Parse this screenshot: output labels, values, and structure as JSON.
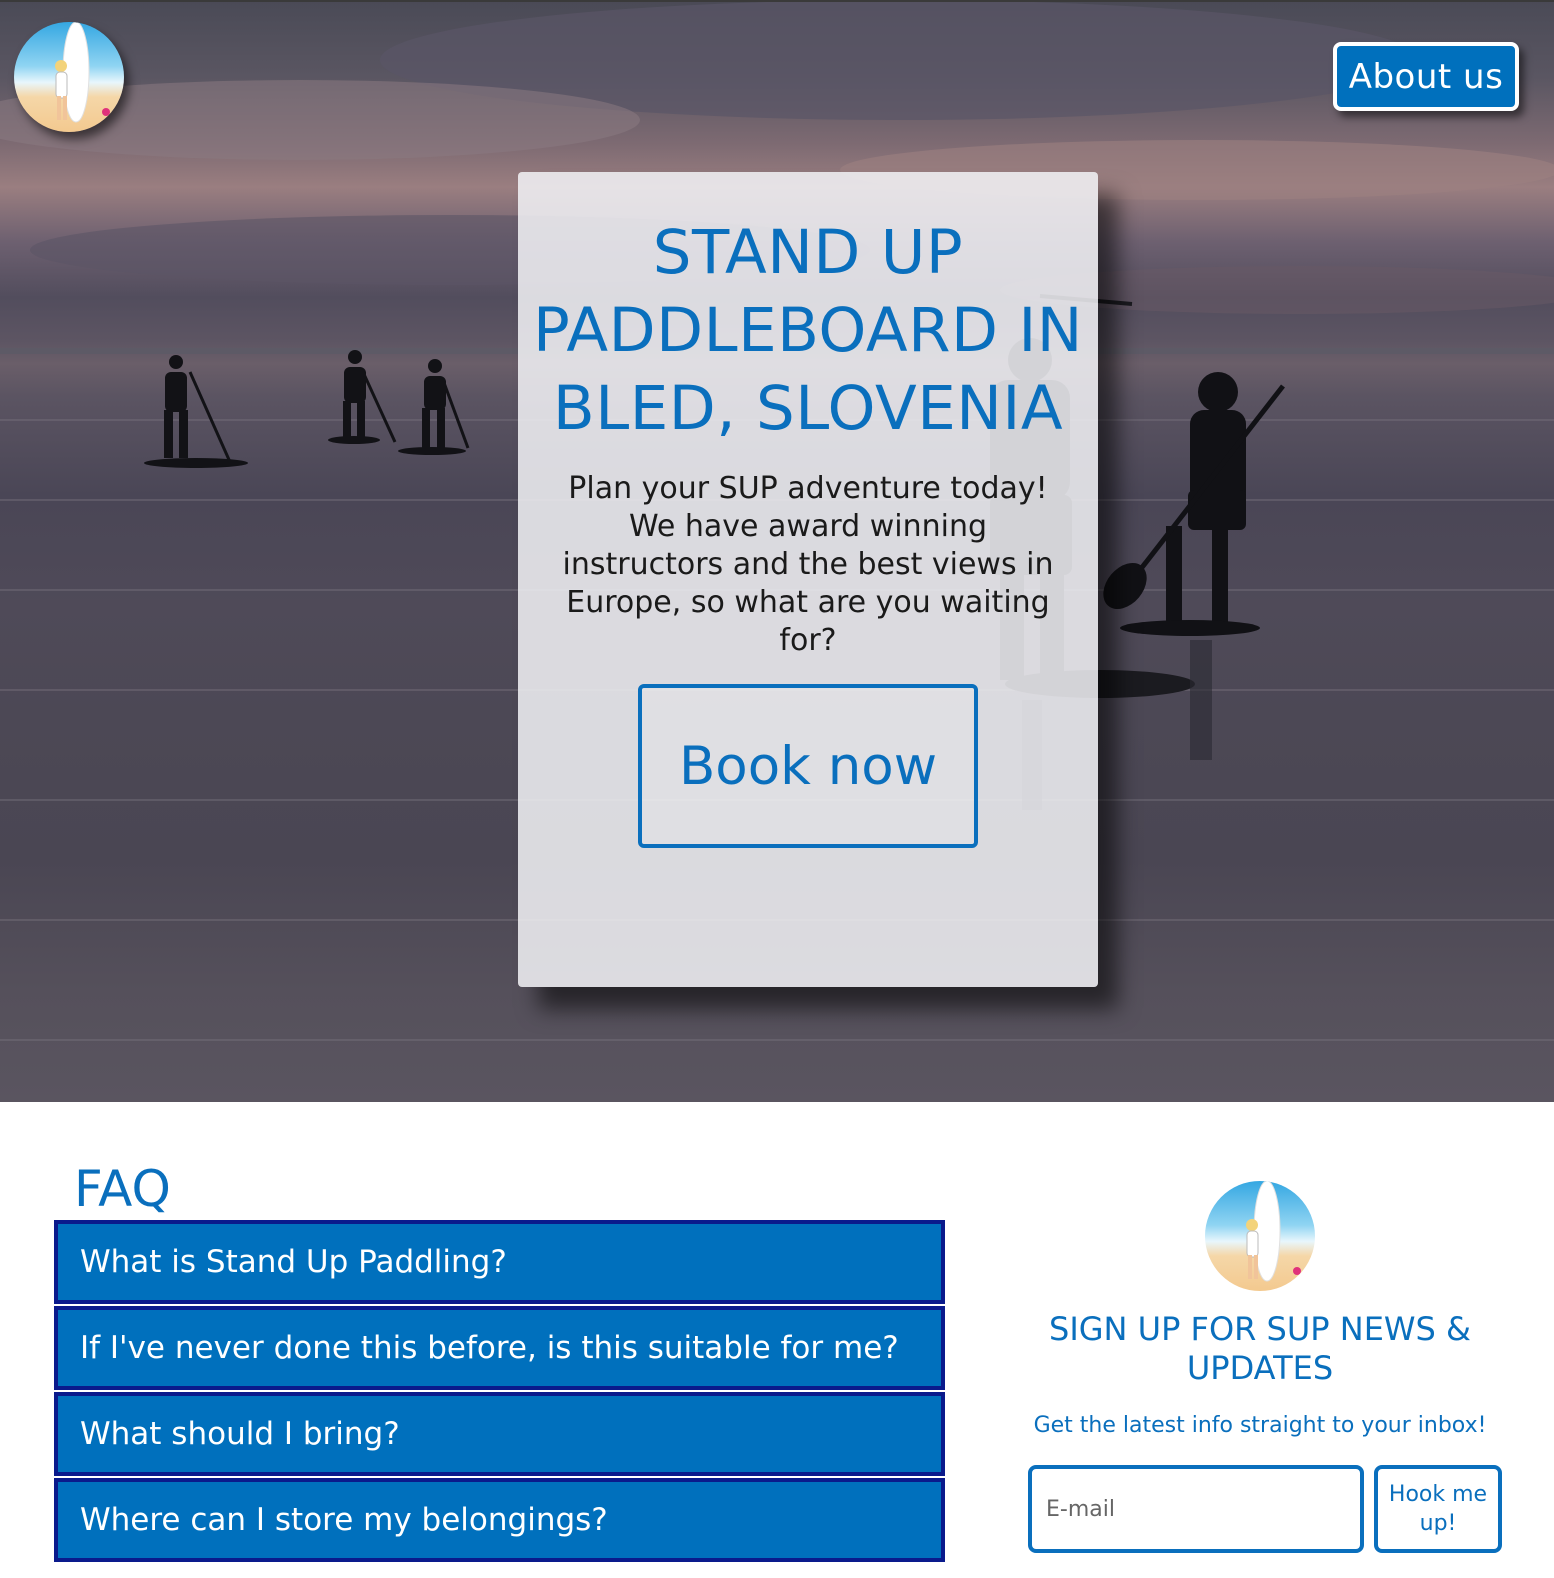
{
  "nav": {
    "logo_icon": "surfer-girl-logo-icon",
    "about_label": "About us"
  },
  "hero": {
    "title": "STAND UP PADDLEBOARD IN BLED, SLOVENIA",
    "subtitle": "Plan your SUP adventure today! We have award winning instructors and the best views in Europe, so what are you waiting for?",
    "book_label": "Book now"
  },
  "faq": {
    "heading": "FAQ",
    "items": [
      "What is Stand Up Paddling?",
      "If I've never done this before, is this suitable for me?",
      "What should I bring?",
      "Where can I store my belongings?"
    ]
  },
  "signup": {
    "logo_icon": "surfer-girl-logo-icon",
    "title": "SIGN UP FOR SUP NEWS & UPDATES",
    "subtitle": "Get the latest info straight to your inbox!",
    "email_placeholder": "E-mail",
    "submit_label": "Hook me up!"
  },
  "colors": {
    "brand_blue": "#0070bd",
    "heading_blue": "#0a6fbd",
    "faq_border": "#0a1a8c",
    "card_bg": "#f2f2f6"
  }
}
